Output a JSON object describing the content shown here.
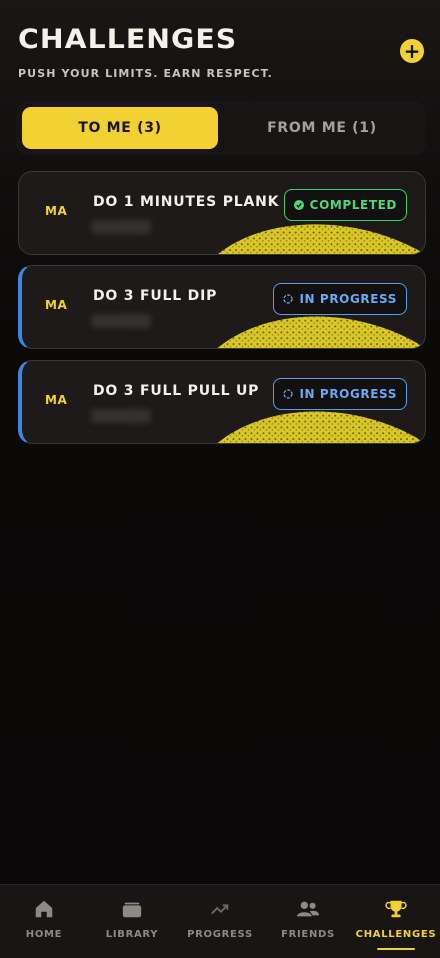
{
  "header": {
    "title": "CHALLENGES",
    "subtitle": "PUSH YOUR LIMITS. EARN RESPECT.",
    "add_icon": "plus-icon"
  },
  "tabs": [
    {
      "label": "TO ME (3)",
      "active": true
    },
    {
      "label": "FROM ME (1)",
      "active": false
    }
  ],
  "challenges": [
    {
      "avatar": "MA",
      "title": "DO 1 MINUTES PLANK",
      "status": "COMPLETED",
      "status_icon": "check-circle-icon",
      "status_color": "#4ed77a"
    },
    {
      "avatar": "MA",
      "title": "DO 3 FULL DIP",
      "status": "IN PROGRESS",
      "status_icon": "progress-circle-icon",
      "status_color": "#6aa9f0"
    },
    {
      "avatar": "MA",
      "title": "DO 3 FULL PULL UP",
      "status": "IN PROGRESS",
      "status_icon": "progress-circle-icon",
      "status_color": "#6aa9f0"
    }
  ],
  "nav": [
    {
      "label": "HOME",
      "icon": "home-icon",
      "active": false
    },
    {
      "label": "LIBRARY",
      "icon": "library-icon",
      "active": false
    },
    {
      "label": "PROGRESS",
      "icon": "trending-up-icon",
      "active": false
    },
    {
      "label": "FRIENDS",
      "icon": "friends-icon",
      "active": false
    },
    {
      "label": "CHALLENGES",
      "icon": "trophy-icon",
      "active": true
    }
  ],
  "colors": {
    "accent": "#f2d233",
    "background": "#0b0909",
    "completed": "#4ed77a",
    "in_progress": "#6aa9f0"
  }
}
